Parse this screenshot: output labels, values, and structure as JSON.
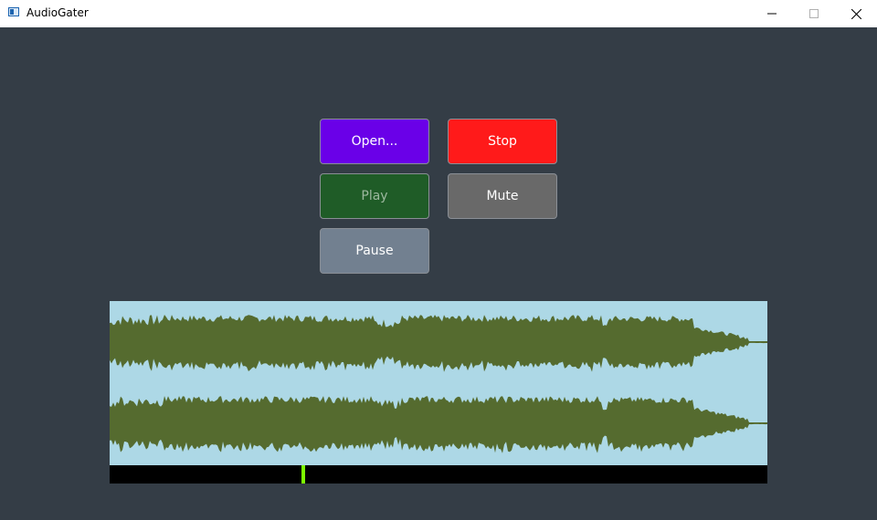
{
  "window": {
    "title": "AudioGater",
    "minimize_icon": "minimize-icon",
    "maximize_icon": "maximize-icon",
    "close_icon": "close-icon"
  },
  "controls": {
    "open_label": "Open...",
    "stop_label": "Stop",
    "play_label": "Play",
    "mute_label": "Mute",
    "pause_label": "Pause",
    "play_enabled": false
  },
  "colors": {
    "background": "#343d46",
    "open": "#6a00e8",
    "stop": "#ff1a1a",
    "play": "#1f5c27",
    "mute": "#696969",
    "pause": "#728090",
    "waveform_bg": "#add8e6",
    "waveform_fill": "#556b2f",
    "timeline_bg": "#000000",
    "playhead": "#7cfc00"
  },
  "playback": {
    "position_fraction": 0.295,
    "channels": 2
  }
}
